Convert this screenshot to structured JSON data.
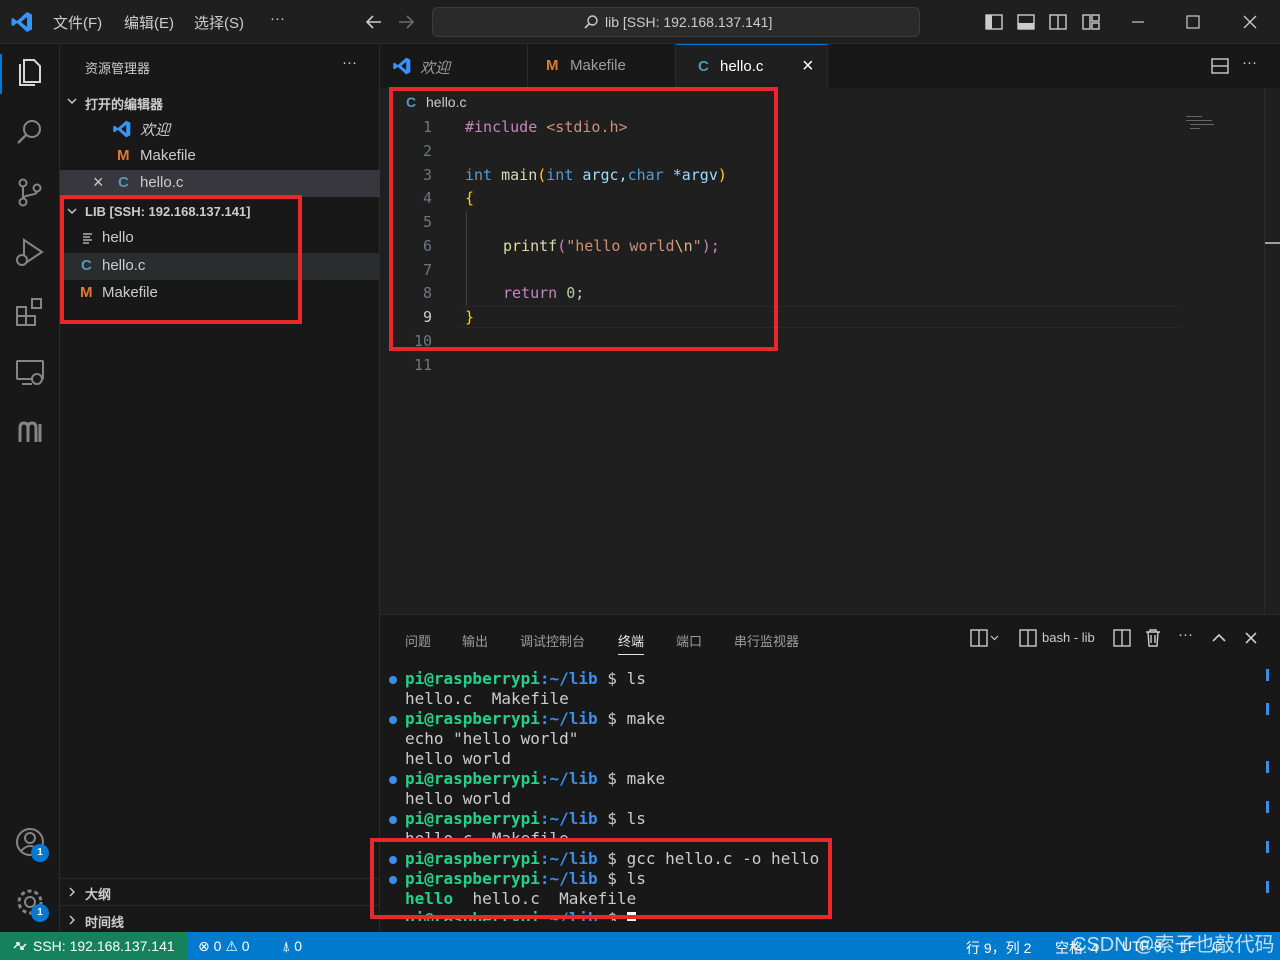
{
  "titlebar": {
    "menu": [
      "文件(F)",
      "编辑(E)",
      "选择(S)",
      "···"
    ],
    "search": "lib [SSH: 192.168.137.141]"
  },
  "sidebar": {
    "title": "资源管理器",
    "more": "···",
    "open_editors_header": "打开的编辑器",
    "open_editors": [
      {
        "label": "欢迎",
        "icon": "vscode-icon"
      },
      {
        "label": "Makefile",
        "icon": "makefile-icon"
      },
      {
        "label": "hello.c",
        "icon": "c-file-icon",
        "close": "×"
      }
    ],
    "folder_header": "LIB [SSH: 192.168.137.141]",
    "files": [
      {
        "label": "hello",
        "icon": "file-lines-icon"
      },
      {
        "label": "hello.c",
        "icon": "c-file-icon"
      },
      {
        "label": "Makefile",
        "icon": "makefile-icon"
      }
    ],
    "outline": "大纲",
    "timeline": "时间线"
  },
  "tabs": [
    {
      "label": "欢迎",
      "icon": "vscode-icon"
    },
    {
      "label": "Makefile",
      "icon": "M"
    },
    {
      "label": "hello.c",
      "icon": "C",
      "close": "×"
    }
  ],
  "editor": {
    "breadcrumb": "hello.c",
    "breadcrumb_icon": "C",
    "line_numbers": [
      "1",
      "2",
      "3",
      "4",
      "5",
      "6",
      "7",
      "8",
      "9",
      "10",
      "11"
    ],
    "code": {
      "l1_a": "#include ",
      "l1_b": "<stdio.h>",
      "l3_int": "int",
      "l3_main": "main",
      "l3_p1": "(",
      "l3_int2": "int",
      "l3_argc": " argc,",
      "l3_char": "char",
      "l3_argv": " *argv",
      "l3_p2": ")",
      "l4": "{",
      "l6_fn": "printf",
      "l6_p1": "(",
      "l6_str1": "\"hello world",
      "l6_esc": "\\n",
      "l6_str2": "\"",
      "l6_p2": ");",
      "l8_kw": "return",
      "l8_num": " 0",
      "l8_semi": ";",
      "l9": "}"
    }
  },
  "panel": {
    "tabs": [
      "问题",
      "输出",
      "调试控制台",
      "终端",
      "端口",
      "串行监视器"
    ],
    "active_tab": "终端",
    "terminal_name": "bash - lib",
    "more": "···",
    "prompt_user": "pi@raspberrypi",
    "prompt_path": ":~/lib",
    "prompt_sign": " $ ",
    "lines": [
      {
        "type": "prompt",
        "cmd": "ls"
      },
      {
        "type": "out",
        "text": "hello.c  Makefile"
      },
      {
        "type": "prompt",
        "cmd": "make"
      },
      {
        "type": "out",
        "text": "echo \"hello world\""
      },
      {
        "type": "out",
        "text": "hello world"
      },
      {
        "type": "prompt",
        "cmd": "make"
      },
      {
        "type": "out",
        "text": "hello world"
      },
      {
        "type": "prompt",
        "cmd": "ls"
      },
      {
        "type": "out",
        "text": "hello.c  Makefile"
      },
      {
        "type": "prompt",
        "cmd": "gcc hello.c -o hello"
      },
      {
        "type": "prompt",
        "cmd": "ls"
      },
      {
        "type": "out2",
        "exe": "hello",
        "text": "  hello.c  Makefile"
      },
      {
        "type": "prompt",
        "cmd": ""
      }
    ]
  },
  "status": {
    "remote": "SSH: 192.168.137.141",
    "errors": "0",
    "warnings": "0",
    "ports": "0",
    "position": "行 9，列 2",
    "spaces": "空格: 4",
    "encoding": "UTF-8",
    "eol": "LF",
    "lang": "C",
    "watermark": "CSDN @索子也敲代码"
  },
  "activity": {
    "account_badge": "1",
    "settings_badge": "1"
  },
  "colors": {
    "accent": "#007acc",
    "remote": "#16825d",
    "highlight_box": "#e8282b"
  }
}
